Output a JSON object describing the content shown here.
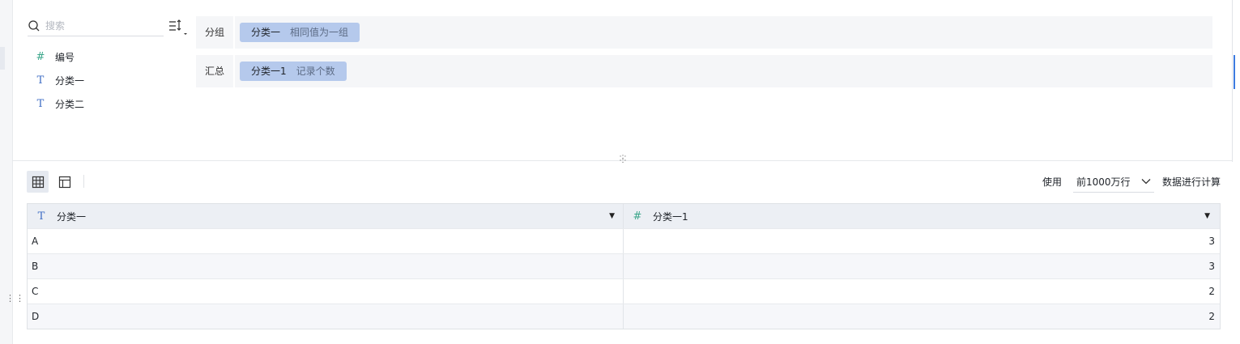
{
  "search": {
    "placeholder": "搜索"
  },
  "fields": [
    {
      "type_icon": "#",
      "type": "number",
      "label": "编号"
    },
    {
      "type_icon": "T",
      "type": "text",
      "label": "分类一"
    },
    {
      "type_icon": "T",
      "type": "text",
      "label": "分类二"
    }
  ],
  "group": {
    "label": "分组",
    "chip_name": "分类一",
    "chip_sub": "相同值为一组"
  },
  "summary": {
    "label": "汇总",
    "chip_name": "分类一1",
    "chip_sub": "记录个数"
  },
  "toolbar": {
    "use_label": "使用",
    "limit_value": "前1000万行",
    "compute_label": "数据进行计算"
  },
  "table": {
    "columns": [
      {
        "icon": "T",
        "type": "text",
        "name": "分类一"
      },
      {
        "icon": "#",
        "type": "number",
        "name": "分类一1"
      }
    ],
    "rows": [
      {
        "c1": "A",
        "c2": "3"
      },
      {
        "c1": "B",
        "c2": "3"
      },
      {
        "c1": "C",
        "c2": "2"
      },
      {
        "c1": "D",
        "c2": "2"
      }
    ]
  },
  "colors": {
    "chip": "#b5c9ec",
    "number_icon": "#3aa68a",
    "text_icon": "#3d6cc4",
    "accent": "#3d7be0"
  }
}
